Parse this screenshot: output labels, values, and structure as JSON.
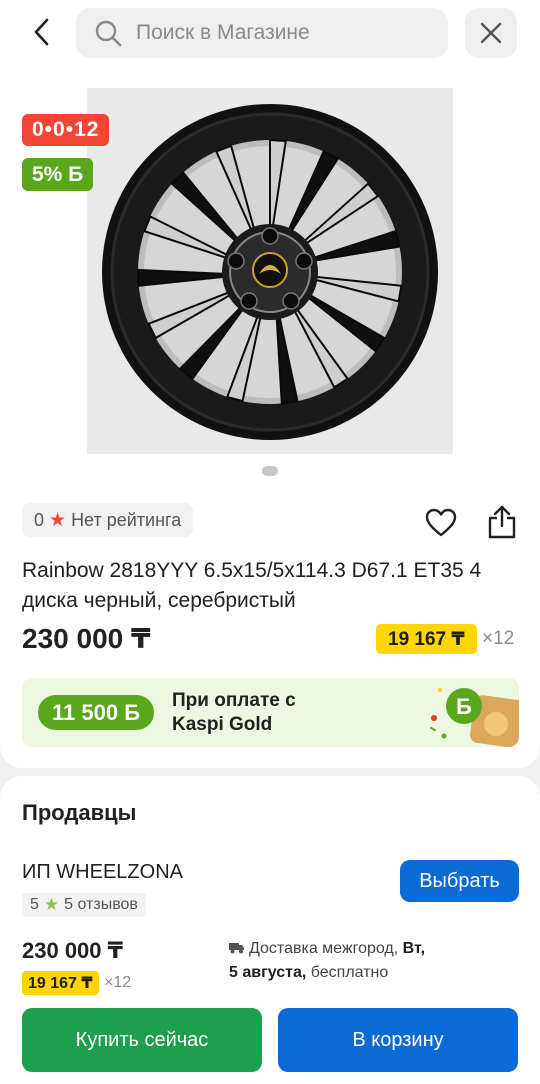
{
  "search": {
    "placeholder": "Поиск в Магазине"
  },
  "product": {
    "badge_installment": "0•0•12",
    "badge_bonus": "5% Б",
    "rating_value": "0",
    "rating_text": "Нет рейтинга",
    "title": "Rainbow 2818YYY 6.5x15/5x114.3 D67.1 ET35 4 диска черный, серебристый",
    "price": "230 000 ₸",
    "monthly": "19 167 ₸",
    "monthly_mult": "×12"
  },
  "gold_banner": {
    "bonus": "11 500 Б",
    "text": "При оплате с Kaspi Gold"
  },
  "sellers": {
    "title": "Продавцы",
    "seller_name": "ИП WHEELZONA",
    "rating_value": "5",
    "reviews": "5 отзывов",
    "choose_label": "Выбрать",
    "price": "230 000 ₸",
    "monthly": "19 167 ₸",
    "monthly_mult": "×12",
    "delivery_prefix": "Доставка межгород, ",
    "delivery_day": "Вт,",
    "delivery_date": "5 августа,",
    "delivery_suffix": " бесплатно"
  },
  "actions": {
    "buy_now": "Купить сейчас",
    "add_to_cart": "В корзину"
  },
  "colors": {
    "accent_blue": "#0a6bd7",
    "buy_green": "#1ca04d",
    "bonus_green": "#5aa71c",
    "installment_red": "#f14635",
    "monthly_yellow": "#ffd600"
  },
  "icons": [
    "back-icon",
    "search-icon",
    "close-icon",
    "star-icon",
    "heart-icon",
    "share-icon",
    "truck-icon"
  ]
}
